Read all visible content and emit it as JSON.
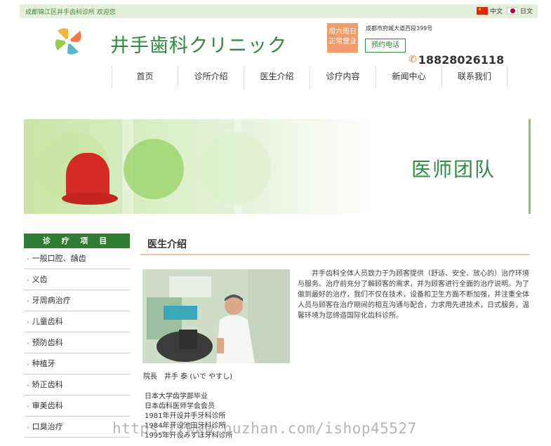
{
  "topbar": {
    "welcome": "成都锦江区井手齿科诊所 欢迎您",
    "lang_cn": "中文",
    "lang_jp": "日文"
  },
  "header": {
    "brand": "井手歯科クリニック",
    "hours_line1": "周六周日",
    "hours_line2": "正常营业",
    "address": "成都市府城大道西段399号",
    "call_button": "预约电话",
    "phone": "18828026118"
  },
  "nav": {
    "items": [
      "首页",
      "诊所介绍",
      "医生介绍",
      "诊疗内容",
      "新闻中心",
      "联系我们"
    ]
  },
  "banner": {
    "title": "医师团队"
  },
  "sidebar": {
    "heading": "诊 疗 项 目",
    "items": [
      "一般口腔、龋齿",
      "义齿",
      "牙周病治疗",
      "儿童齿科",
      "预防齿科",
      "种植牙",
      "矫正齿科",
      "审美齿科",
      "口臭治疗"
    ]
  },
  "main": {
    "section_title": "医生介绍",
    "intro": "井手齿科全体人员致力于为顾客提供（舒适、安全、放心的）治疗环境与服务。治疗前充分了解顾客的需求，并为顾客进行全面的治疗说明。为了做到最好的治疗，我们不仅在技术，设备和卫生方面不断加强，并注重全体人员与顾客在治疗期间的相互沟通与配合，力求用先进技术，日式服务，温馨环境为您缔造国际化齿科诊所。",
    "doctor_name": "院長　井手 泰 (いで やすし)",
    "career": [
      "日本大学齿学部毕业",
      "日本齿科医师学会会员",
      "1981年开设井手牙科诊所",
      "1984年开设池田牙科诊所",
      "1995年开设みずほ牙科诊所"
    ]
  },
  "watermark": "https://www.huzhan.com/ishop45527",
  "colors": {
    "brand_green": "#2e8b3f",
    "orange_accent": "#f29a68",
    "topbar_bg": "#e5efdc"
  }
}
